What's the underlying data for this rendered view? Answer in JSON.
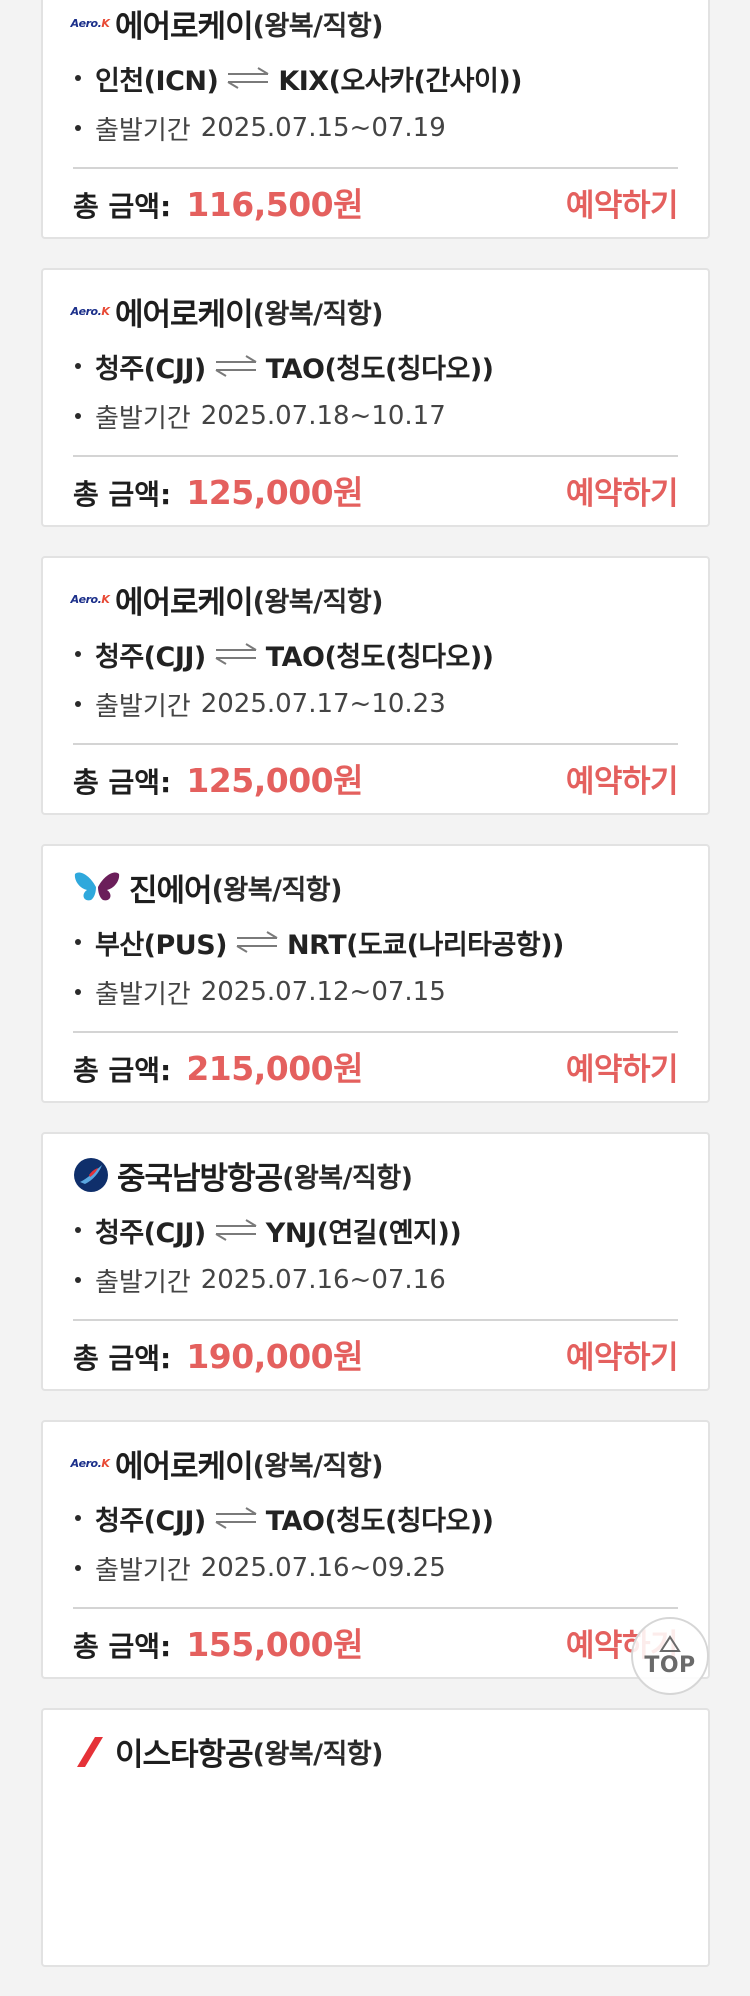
{
  "cards": [
    {
      "airline": "에어로케이",
      "trip_type": "(왕복/직항)",
      "logo": "aerok-logo",
      "logo_text_a": "Aero",
      "logo_text_b": "K",
      "origin": "인천(ICN)",
      "destination": "KIX(오사카(간사이))",
      "period_label": "출발기간",
      "period": "2025.07.15~07.19",
      "total_label": "총 금액:",
      "price": "116,500원",
      "book_label": "예약하기"
    },
    {
      "airline": "에어로케이",
      "trip_type": "(왕복/직항)",
      "logo": "aerok-logo",
      "logo_text_a": "Aero",
      "logo_text_b": "K",
      "origin": "청주(CJJ)",
      "destination": "TAO(청도(칭다오))",
      "period_label": "출발기간",
      "period": "2025.07.18~10.17",
      "total_label": "총 금액:",
      "price": "125,000원",
      "book_label": "예약하기"
    },
    {
      "airline": "에어로케이",
      "trip_type": "(왕복/직항)",
      "logo": "aerok-logo",
      "logo_text_a": "Aero",
      "logo_text_b": "K",
      "origin": "청주(CJJ)",
      "destination": "TAO(청도(칭다오))",
      "period_label": "출발기간",
      "period": "2025.07.17~10.23",
      "total_label": "총 금액:",
      "price": "125,000원",
      "book_label": "예약하기"
    },
    {
      "airline": "진에어",
      "trip_type": "(왕복/직항)",
      "logo": "jinair-butterfly-logo",
      "origin": "부산(PUS)",
      "destination": "NRT(도쿄(나리타공항))",
      "period_label": "출발기간",
      "period": "2025.07.12~07.15",
      "total_label": "총 금액:",
      "price": "215,000원",
      "book_label": "예약하기"
    },
    {
      "airline": "중국남방항공",
      "trip_type": "(왕복/직항)",
      "logo": "china-southern-logo",
      "origin": "청주(CJJ)",
      "destination": "YNJ(연길(옌지))",
      "period_label": "출발기간",
      "period": "2025.07.16~07.16",
      "total_label": "총 금액:",
      "price": "190,000원",
      "book_label": "예약하기"
    },
    {
      "airline": "에어로케이",
      "trip_type": "(왕복/직항)",
      "logo": "aerok-logo",
      "logo_text_a": "Aero",
      "logo_text_b": "K",
      "origin": "청주(CJJ)",
      "destination": "TAO(청도(칭다오))",
      "period_label": "출발기간",
      "period": "2025.07.16~09.25",
      "total_label": "총 금액:",
      "price": "155,000원",
      "book_label": "예약하기"
    },
    {
      "airline": "이스타항공",
      "trip_type": "(왕복/직항)",
      "logo": "eastar-logo"
    }
  ],
  "top_button": {
    "label": "TOP",
    "icon": "triangle-up-icon"
  },
  "colors": {
    "accent": "#e4605e",
    "background": "#f3f3f3",
    "card": "#ffffff",
    "aerok_blue": "#1b2f8a",
    "jinair_blue": "#2fa8dc",
    "jinair_purple": "#6b1e5a",
    "china_southern_navy": "#0f2f6b",
    "eastar_red": "#e53238"
  }
}
